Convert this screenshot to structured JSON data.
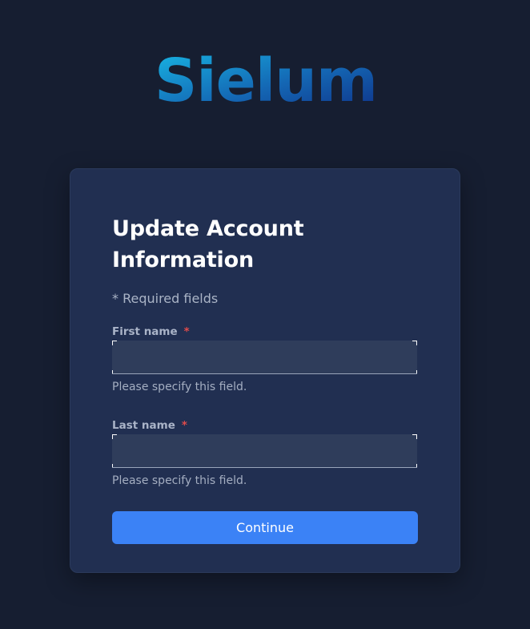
{
  "brand": {
    "logo_text": "Sielum",
    "colors": {
      "light": "#18b9e6",
      "mid": "#1467b4",
      "dark": "#0e2f86"
    }
  },
  "form": {
    "title_line1": "Update Account",
    "title_line2": "Information",
    "required_note": "* Required fields",
    "first_name": {
      "label": "First name",
      "required_mark": "*",
      "value": "",
      "helper": "Please specify this field."
    },
    "last_name": {
      "label": "Last name",
      "required_mark": "*",
      "value": "",
      "helper": "Please specify this field."
    },
    "continue_label": "Continue"
  },
  "colors": {
    "background": "#161e31",
    "card": "#212f51",
    "input": "#2f3d5b",
    "accent": "#3b82f6",
    "required": "#e04b4b"
  }
}
